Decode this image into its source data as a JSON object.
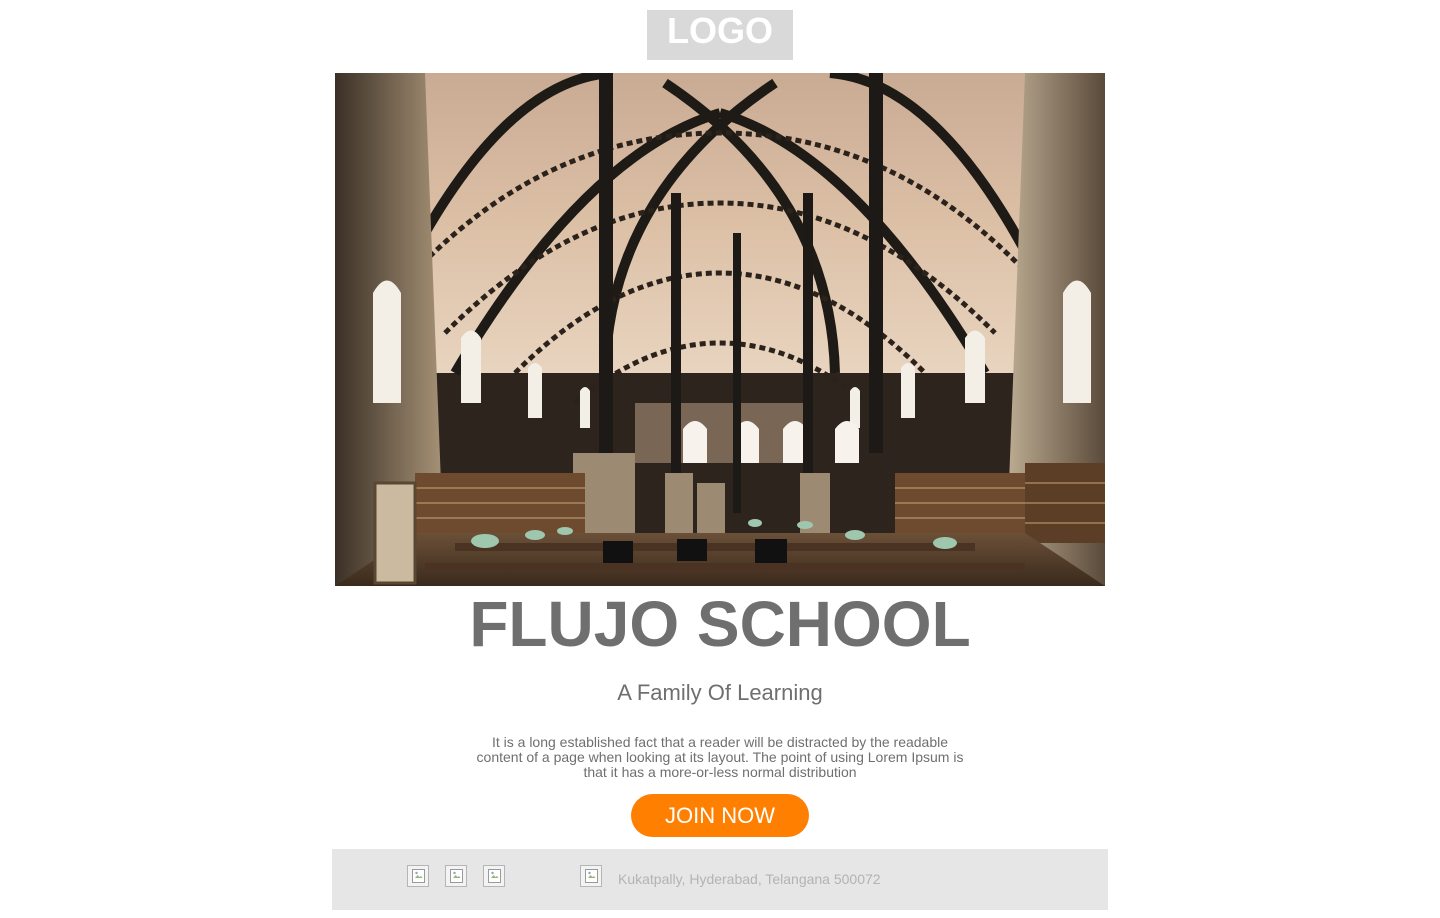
{
  "header": {
    "logo_text": "LOGO"
  },
  "hero": {
    "image_description_icon": "library-hall-image"
  },
  "content": {
    "title": "FLUJO SCHOOL",
    "subtitle": "A Family Of Learning",
    "body": "It is a long established fact that a reader will be distracted by the readable content of a page when looking at its layout. The point of using Lorem Ipsum is that it has a more-or-less normal distribution",
    "cta_label": "JOIN NOW"
  },
  "footer": {
    "social_icons": [
      "broken-image-icon",
      "broken-image-icon",
      "broken-image-icon"
    ],
    "location_icon": "broken-image-icon",
    "address": "Kukatpally, Hyderabad, Telangana 500072"
  },
  "colors": {
    "accent": "#ff7f00",
    "text": "#6f6f6f",
    "logo_bg": "#d9d9d9",
    "footer_bg": "#e6e6e6",
    "footer_text": "#b3b3b3"
  }
}
